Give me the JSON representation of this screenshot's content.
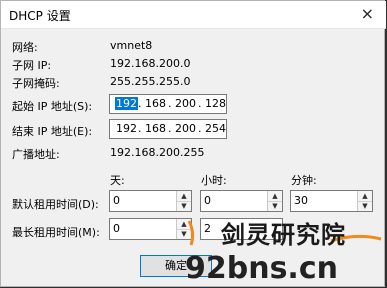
{
  "window": {
    "title": "DHCP 设置",
    "close_icon": "×"
  },
  "info": {
    "network_label": "网络:",
    "network_value": "vmnet8",
    "subnet_ip_label": "子网 IP:",
    "subnet_ip_value": "192.168.200.0",
    "mask_label": "子网掩码:",
    "mask_value": "255.255.255.0",
    "broadcast_label": "广播地址:",
    "broadcast_value": "192.168.200.255"
  },
  "start_ip": {
    "label": "起始 IP 地址(S):",
    "octets": [
      "192",
      "168",
      "200",
      "128"
    ]
  },
  "end_ip": {
    "label": "结束 IP 地址(E):",
    "octets": [
      "192",
      "168",
      "200",
      "254"
    ]
  },
  "lease": {
    "headers": {
      "days": "天:",
      "hours": "小时:",
      "minutes": "分钟:"
    },
    "default_label": "默认租用时间(D):",
    "default_values": {
      "days": "0",
      "hours": "0",
      "minutes": "30"
    },
    "max_label": "最长租用时间(M):",
    "max_values": {
      "days": "0",
      "hours": "2"
    }
  },
  "buttons": {
    "ok": "确定"
  },
  "watermark": {
    "line1": "剑灵研究院",
    "line2": "92bns.cn"
  },
  "colors": {
    "selection": "#0078d7",
    "dialog_bg": "#f0f0f0"
  }
}
